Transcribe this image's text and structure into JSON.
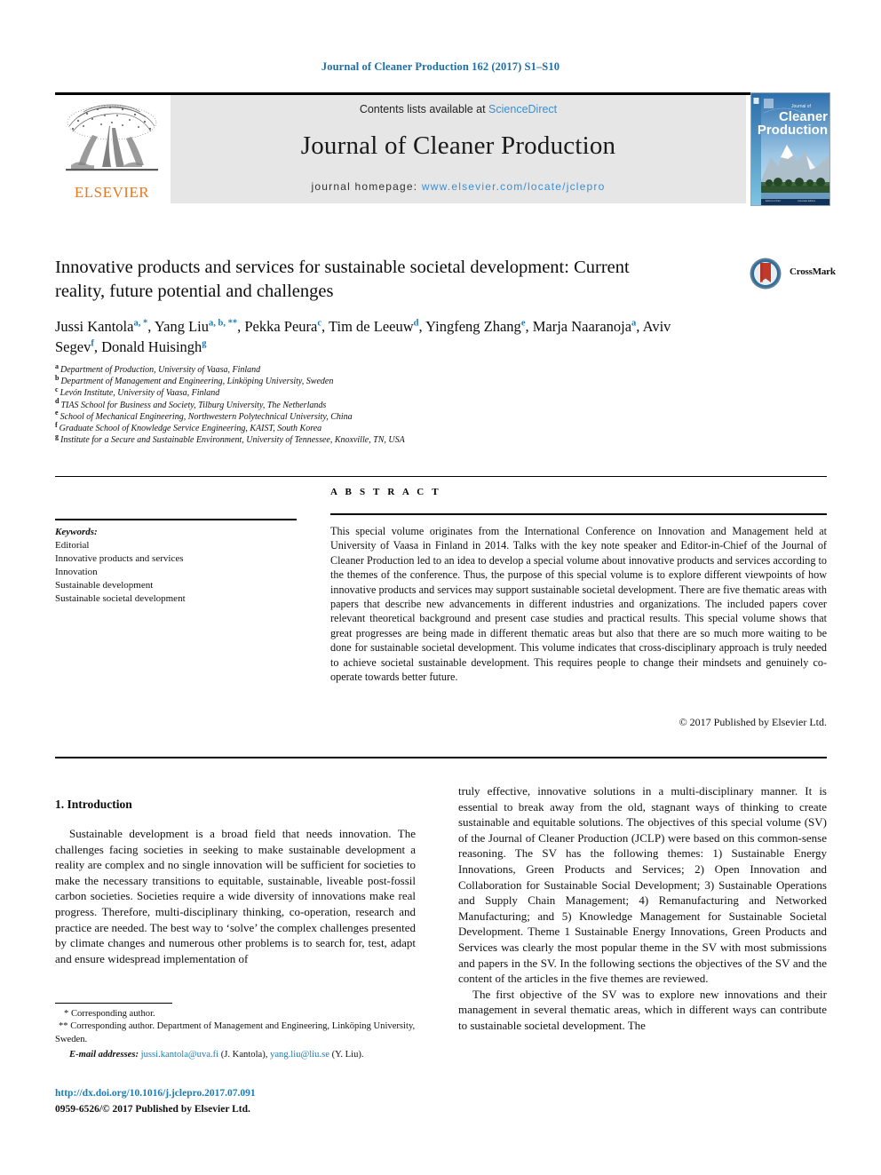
{
  "running_head": "Journal of Cleaner Production 162 (2017) S1–S10",
  "masthead": {
    "contents_prefix": "Contents lists available at ",
    "sciencedirect": "ScienceDirect",
    "journal_title": "Journal of Cleaner Production",
    "homepage_label": "journal homepage: ",
    "homepage_url": "www.elsevier.com/locate/jclepro",
    "publisher_wordmark": "ELSEVIER",
    "cover_title_small": "Journal of",
    "cover_title_line1": "Cleaner",
    "cover_title_line2": "Production"
  },
  "article": {
    "title": "Innovative products and services for sustainable societal development: Current reality, future potential and challenges",
    "crossmark_label": "CrossMark",
    "authors": [
      {
        "name": "Jussi Kantola",
        "marks": "a, *"
      },
      {
        "name": "Yang Liu",
        "marks": "a, b, **"
      },
      {
        "name": "Pekka Peura",
        "marks": "c"
      },
      {
        "name": "Tim de Leeuw",
        "marks": "d"
      },
      {
        "name": "Yingfeng Zhang",
        "marks": "e"
      },
      {
        "name": "Marja Naaranoja",
        "marks": "a"
      },
      {
        "name": "Aviv Segev",
        "marks": "f"
      },
      {
        "name": "Donald Huisingh",
        "marks": "g"
      }
    ],
    "affiliations": [
      {
        "mark": "a",
        "text": "Department of Production, University of Vaasa, Finland"
      },
      {
        "mark": "b",
        "text": "Department of Management and Engineering, Linköping University, Sweden"
      },
      {
        "mark": "c",
        "text": "Levón Institute, University of Vaasa, Finland"
      },
      {
        "mark": "d",
        "text": "TIAS School for Business and Society, Tilburg University, The Netherlands"
      },
      {
        "mark": "e",
        "text": "School of Mechanical Engineering, Northwestern Polytechnical University, China"
      },
      {
        "mark": "f",
        "text": "Graduate School of Knowledge Service Engineering, KAIST, South Korea"
      },
      {
        "mark": "g",
        "text": "Institute for a Secure and Sustainable Environment, University of Tennessee, Knoxville, TN, USA"
      }
    ]
  },
  "keywords": {
    "heading": "Keywords:",
    "items": [
      "Editorial",
      "Innovative products and services",
      "Innovation",
      "Sustainable development",
      "Sustainable societal development"
    ]
  },
  "abstract": {
    "heading": "A B S T R A C T",
    "text": "This special volume originates from the International Conference on Innovation and Management held at University of Vaasa in Finland in 2014. Talks with the key note speaker and Editor-in-Chief of the Journal of Cleaner Production led to an idea to develop a special volume about innovative products and services according to the themes of the conference. Thus, the purpose of this special volume is to explore different viewpoints of how innovative products and services may support sustainable societal development. There are five thematic areas with papers that describe new advancements in different industries and organizations. The included papers cover relevant theoretical background and present case studies and practical results. This special volume shows that great progresses are being made in different thematic areas but also that there are so much more waiting to be done for sustainable societal development. This volume indicates that cross-disciplinary approach is truly needed to achieve societal sustainable development. This requires people to change their mindsets and genuinely co-operate towards better future.",
    "copyright": "© 2017 Published by Elsevier Ltd."
  },
  "body": {
    "section_heading": "1. Introduction",
    "left_paragraph": "Sustainable development is a broad field that needs innovation. The challenges facing societies in seeking to make sustainable development a reality are complex and no single innovation will be sufficient for societies to make the necessary transitions to equitable, sustainable, liveable post-fossil carbon societies. Societies require a wide diversity of innovations make real progress. Therefore, multi-disciplinary thinking, co-operation, research and practice are needed. The best way to ‘solve’ the complex challenges presented by climate changes and numerous other problems is to search for, test, adapt and ensure widespread implementation of",
    "right_paragraph_1": "truly effective, innovative solutions in a multi-disciplinary manner. It is essential to break away from the old, stagnant ways of thinking to create sustainable and equitable solutions. The objectives of this special volume (SV) of the Journal of Cleaner Production (JCLP) were based on this common-sense reasoning. The SV has the following themes: 1) Sustainable Energy Innovations, Green Products and Services; 2) Open Innovation and Collaboration for Sustainable Social Development; 3) Sustainable Operations and Supply Chain Management; 4) Remanufacturing and Networked Manufacturing; and 5) Knowledge Management for Sustainable Societal Development. Theme 1 Sustainable Energy Innovations, Green Products and Services was clearly the most popular theme in the SV with most submissions and papers in the SV. In the following sections the objectives of the SV and the content of the articles in the five themes are reviewed.",
    "right_paragraph_2": "The first objective of the SV was to explore new innovations and their management in several thematic areas, which in different ways can contribute to sustainable societal development. The"
  },
  "footnotes": {
    "corresponding_1": "* Corresponding author.",
    "corresponding_2": "** Corresponding author. Department of Management and Engineering, Linköping University, Sweden.",
    "emails_label": "E-mail addresses:",
    "email_1": "jussi.kantola@uva.fi",
    "email_1_owner": "(J. Kantola),",
    "email_2": "yang.liu@liu.se",
    "email_2_owner": "(Y. Liu).",
    "doi": "http://dx.doi.org/10.1016/j.jclepro.2017.07.091",
    "issn_line": "0959-6526/© 2017 Published by Elsevier Ltd."
  },
  "colors": {
    "link_blue": "#1b7cb5",
    "sciencedirect_blue": "#3a8fd0",
    "elsevier_orange": "#e87722",
    "band_gray": "#e6e6e6"
  }
}
